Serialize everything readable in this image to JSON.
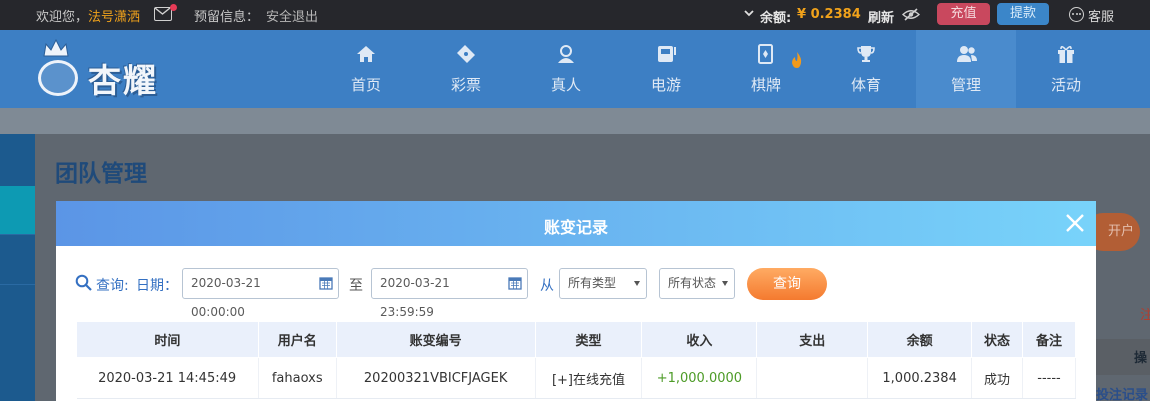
{
  "topbar": {
    "welcome": "欢迎您，",
    "username": "法号潇洒",
    "reserve_label": "预留信息：",
    "logout": "安全退出",
    "balance_label": "余额:",
    "balance_value": "¥ 0.2384",
    "refresh": "刷新",
    "recharge": "充值",
    "withdraw": "提款",
    "service": "客服"
  },
  "header": {
    "logo_text": "杏耀",
    "nav": [
      {
        "label": "首页",
        "icon": "home-icon"
      },
      {
        "label": "彩票",
        "icon": "ticket-icon"
      },
      {
        "label": "真人",
        "icon": "dealer-icon"
      },
      {
        "label": "电游",
        "icon": "slot-icon"
      },
      {
        "label": "棋牌",
        "icon": "cards-icon"
      },
      {
        "label": "体育",
        "icon": "trophy-icon"
      },
      {
        "label": "管理",
        "icon": "users-icon"
      },
      {
        "label": "活动",
        "icon": "gift-icon"
      }
    ],
    "active_nav": "管理"
  },
  "page": {
    "title": "团队管理",
    "bg_button": "开户",
    "bg_mark": "注",
    "bg_header": "操",
    "bg_link": "投注记录"
  },
  "modal": {
    "title": "账变记录",
    "query_label": "查询:",
    "date_label": "日期：",
    "start_date": "2020-03-21 00:00:00",
    "to_label": "至",
    "end_date": "2020-03-21 23:59:59",
    "from_label": "从",
    "type_select": "所有类型",
    "status_select": "所有状态",
    "query_button": "查询",
    "columns": [
      "时间",
      "用户名",
      "账变编号",
      "类型",
      "收入",
      "支出",
      "余额",
      "状态",
      "备注"
    ],
    "rows": [
      [
        "2020-03-21 14:45:49",
        "fahaoxs",
        "20200321VBICFJAGEK",
        "[+]在线充值",
        "+1,000.0000",
        "",
        "1,000.2384",
        "成功",
        "-----"
      ]
    ]
  },
  "colors": {
    "topbar_bg": "#26272c",
    "header_bg": "#3d7fc4",
    "accent_orange": "#f0a21b",
    "income_green": "#4d9b27",
    "query_button": "#f47a2f"
  }
}
